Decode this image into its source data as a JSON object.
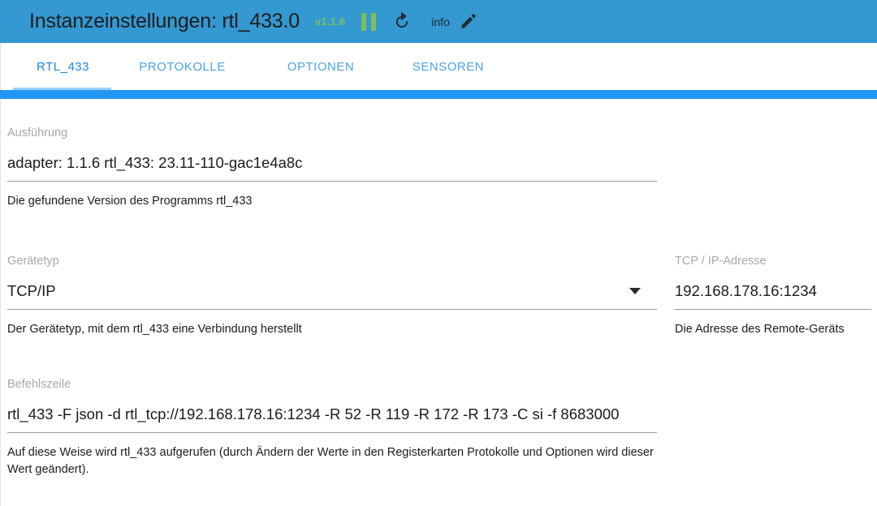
{
  "header": {
    "title": "Instanzeinstellungen: rtl_433.0",
    "version": "v1.1.6",
    "info_label": "info",
    "icons": {
      "pause": "pause-icon",
      "refresh": "refresh-icon",
      "edit": "pencil-icon"
    },
    "colors": {
      "bar": "#3498d1",
      "version_green": "#7cc05b",
      "progress": "#2196f3",
      "progress_buffer": "#9ed0f7"
    }
  },
  "tabs": [
    {
      "label": "RTL_433",
      "active": true
    },
    {
      "label": "PROTOKOLLE",
      "active": false
    },
    {
      "label": "OPTIONEN",
      "active": false
    },
    {
      "label": "SENSOREN",
      "active": false
    }
  ],
  "fields": {
    "ausfuehrung": {
      "label": "Ausführung",
      "value": "adapter: 1.1.6   rtl_433: 23.11-110-gac1e4a8c",
      "help": "Die gefundene Version des Programms rtl_433"
    },
    "geraetetyp": {
      "label": "Gerätetyp",
      "value": "TCP/IP",
      "help": "Der Gerätetyp, mit dem rtl_433 eine Verbindung herstellt"
    },
    "tcpip": {
      "label": "TCP / IP-Adresse",
      "value": "192.168.178.16:1234",
      "help": "Die Adresse des Remote-Geräts"
    },
    "befehlszeile": {
      "label": "Befehlszeile",
      "value": "rtl_433 -F json -d rtl_tcp://192.168.178.16:1234 -R 52 -R 119 -R 172 -R 173 -C si -f 8683000",
      "help": "Auf diese Weise wird rtl_433 aufgerufen (durch Ändern der Werte in den Registerkarten Protokolle und Optionen wird dieser Wert geändert)."
    }
  }
}
